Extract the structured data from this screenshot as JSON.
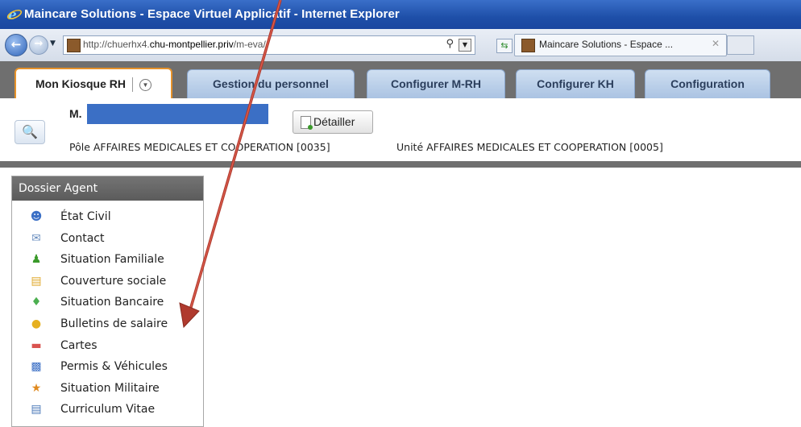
{
  "window": {
    "title": "Maincare Solutions - Espace Virtuel Applicatif - Internet Explorer"
  },
  "browser": {
    "url_prefix": "http://chuerhx4.",
    "url_host": "chu-montpellier.priv",
    "url_path": "/m-eva/",
    "tab_label": "Maincare Solutions - Espace ..."
  },
  "app_tabs": [
    {
      "label": "Mon Kiosque RH",
      "active": true
    },
    {
      "label": "Gestion du personnel"
    },
    {
      "label": "Configurer M-RH"
    },
    {
      "label": "Configurer KH"
    },
    {
      "label": "Configuration"
    }
  ],
  "header": {
    "agent_name": "M.",
    "details_button": "Détailler",
    "pole": "Pôle AFFAIRES MEDICALES ET COOPERATION [0035]",
    "unite": "Unité AFFAIRES MEDICALES ET COOPERATION [0005]"
  },
  "sidebar": {
    "title": "Dossier Agent",
    "items": [
      {
        "label": "État Civil",
        "icon": "person-icon"
      },
      {
        "label": "Contact",
        "icon": "envelope-icon"
      },
      {
        "label": "Situation Familiale",
        "icon": "family-icon"
      },
      {
        "label": "Couverture sociale",
        "icon": "folder-icon"
      },
      {
        "label": "Situation Bancaire",
        "icon": "banknote-icon"
      },
      {
        "label": "Bulletins de salaire",
        "icon": "coins-icon"
      },
      {
        "label": "Cartes",
        "icon": "card-icon"
      },
      {
        "label": "Permis & Véhicules",
        "icon": "car-icon"
      },
      {
        "label": "Situation Militaire",
        "icon": "medal-icon"
      },
      {
        "label": "Curriculum Vitae",
        "icon": "document-icon"
      }
    ]
  },
  "colors": {
    "accent_tab_border": "#e6922a",
    "redaction": "#3b6fc5",
    "annotation_arrow": "#c0392b"
  }
}
